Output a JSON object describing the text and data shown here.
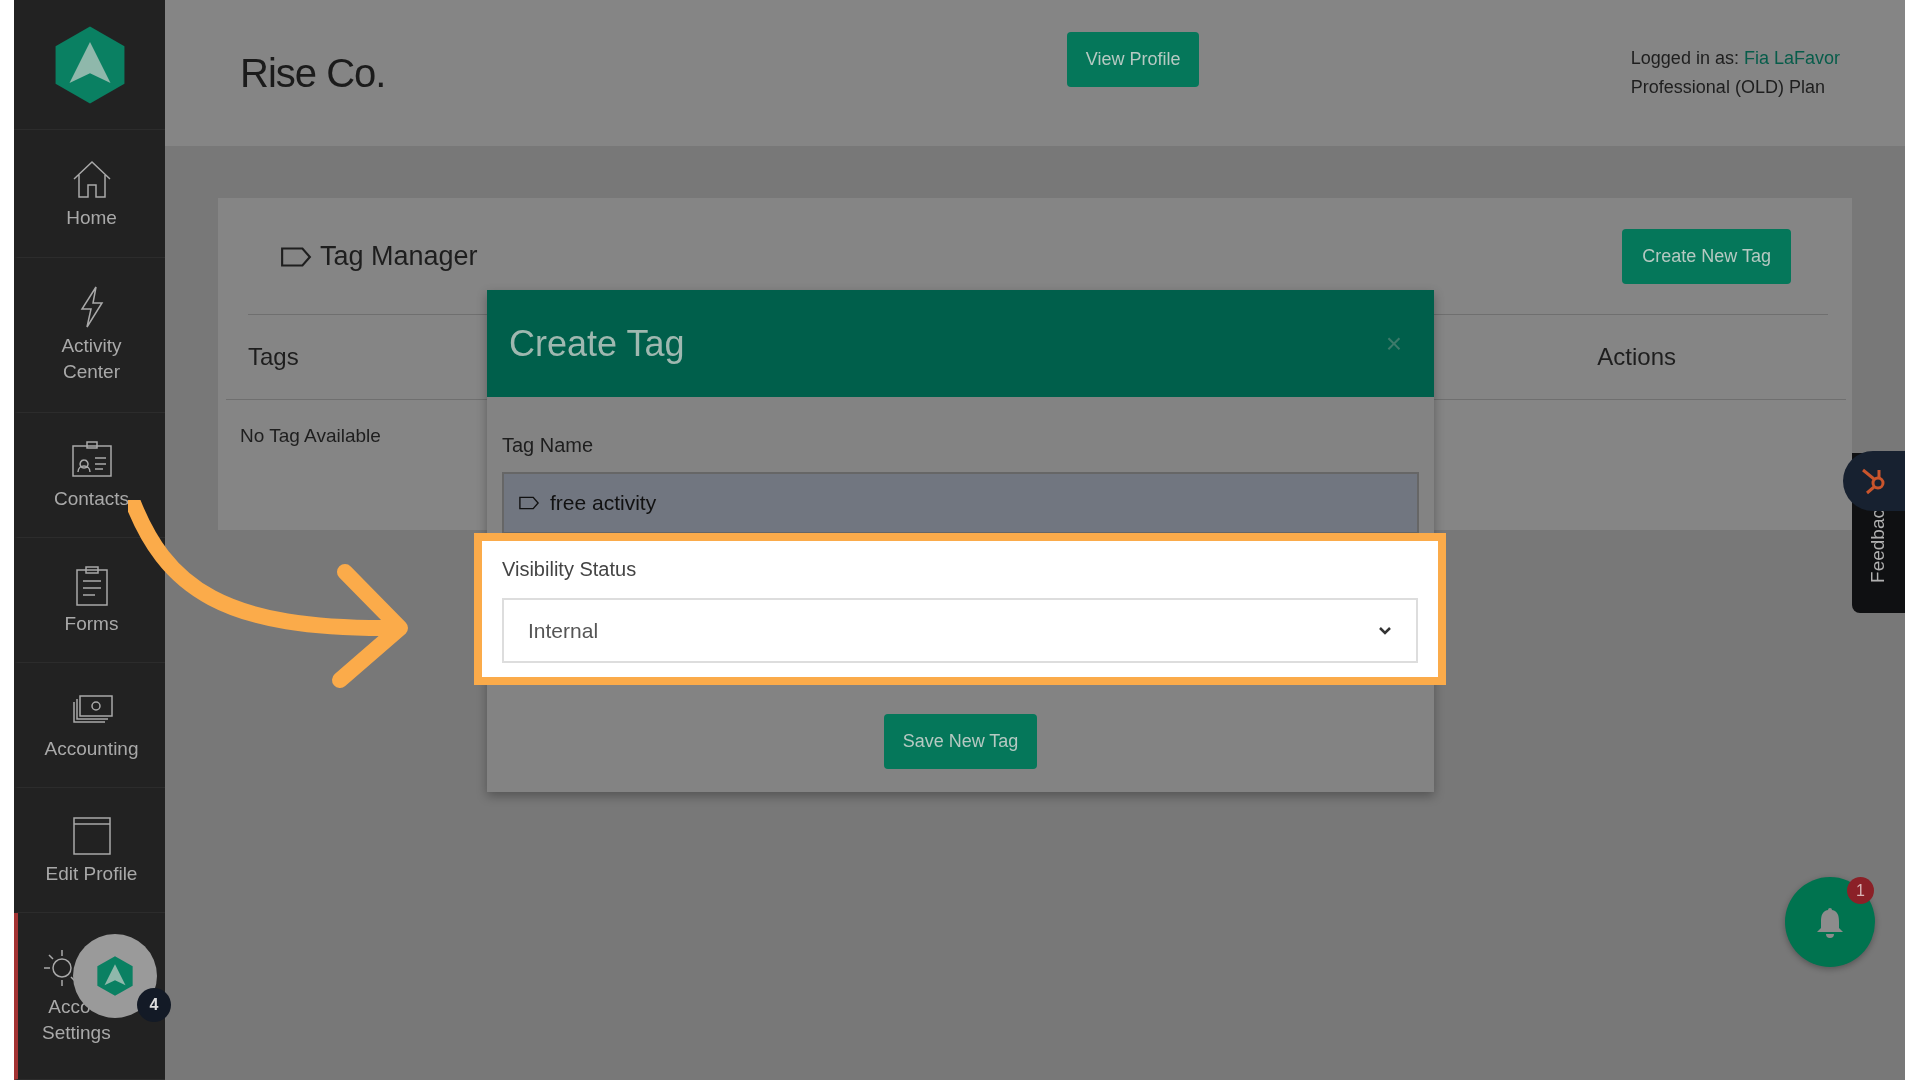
{
  "sidebar": {
    "items": [
      {
        "kind": "home",
        "lines": [
          "Home"
        ],
        "selected": false
      },
      {
        "kind": "bolt",
        "lines": [
          "Activity",
          "Center"
        ],
        "selected": false
      },
      {
        "kind": "contacts",
        "lines": [
          "Contacts"
        ],
        "selected": false
      },
      {
        "kind": "forms",
        "lines": [
          "Forms"
        ],
        "selected": false
      },
      {
        "kind": "accounting",
        "lines": [
          "Accounting"
        ],
        "selected": false
      },
      {
        "kind": "profile",
        "lines": [
          "Edit Profile"
        ],
        "selected": false
      },
      {
        "kind": "settings",
        "lines": [
          "Acco",
          "Settings"
        ],
        "selected": true
      }
    ]
  },
  "header": {
    "company": "Rise Co.",
    "view_profile": "View Profile",
    "logged_in_label": "Logged in as:",
    "user": "Fia LaFavor",
    "plan": "Professional (OLD) Plan"
  },
  "tag_manager": {
    "title": "Tag Manager",
    "create_button": "Create New Tag",
    "columns": [
      "Tags",
      "Actions"
    ],
    "empty_text": "No Tag Available"
  },
  "modal": {
    "title": "Create Tag",
    "close": "×",
    "name_label": "Tag Name",
    "name_value": "free activity",
    "visibility_label": "Visibility Status",
    "visibility_value": "Internal",
    "save_button": "Save New Tag"
  },
  "feedback": {
    "label": "Feedbac"
  },
  "notifications": {
    "count": "1"
  },
  "assistant": {
    "count": "4"
  }
}
